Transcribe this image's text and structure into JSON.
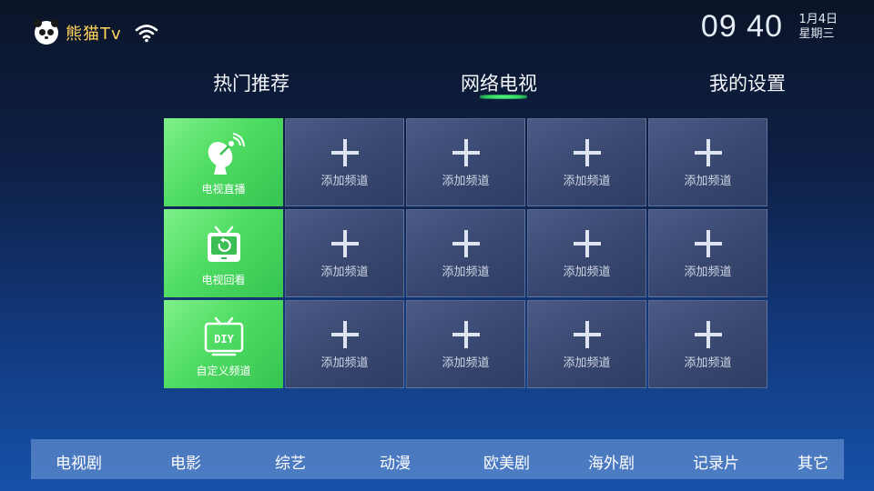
{
  "brand": {
    "name": "熊猫Tv",
    "logo_icon": "panda-logo-icon",
    "wifi_icon": "wifi-icon"
  },
  "status": {
    "time": "09 40",
    "date": "1月4日",
    "weekday": "星期三"
  },
  "tabs": [
    {
      "label": "热门推荐",
      "selected": false
    },
    {
      "label": "网络电视",
      "selected": true
    },
    {
      "label": "我的设置",
      "selected": false
    }
  ],
  "grid": {
    "feature_tiles": [
      {
        "label": "电视直播",
        "icon": "satellite-dish-icon"
      },
      {
        "label": "电视回看",
        "icon": "tv-replay-icon"
      },
      {
        "label": "自定义频道",
        "icon": "diy-tv-icon",
        "icon_text": "DIY"
      }
    ],
    "add_label": "添加频道",
    "add_icon": "plus-icon"
  },
  "categories": [
    "电视剧",
    "电影",
    "综艺",
    "动漫",
    "欧美剧",
    "海外剧",
    "记录片",
    "其它"
  ],
  "colors": {
    "accent_green": "#4fdc63",
    "brand_yellow": "#ffd45a",
    "tile_blue": "#3c4a72"
  }
}
